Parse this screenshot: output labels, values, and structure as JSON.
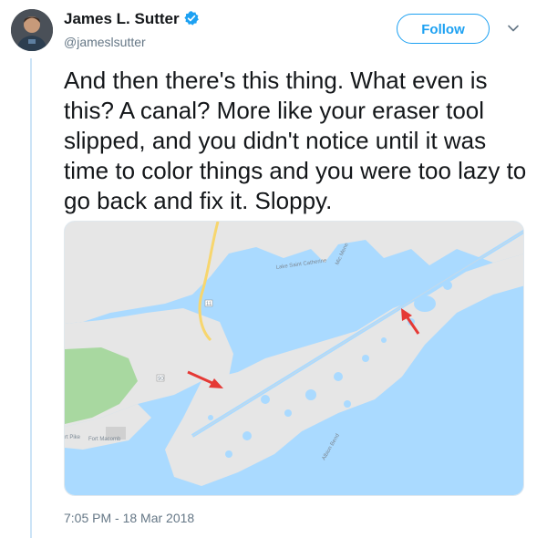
{
  "author": {
    "name": "James L. Sutter",
    "handle": "@jameslsutter",
    "verified": true
  },
  "follow_button": {
    "label": "Follow"
  },
  "tweet": {
    "text": "And then there's this thing. What even is this? A canal? More like your eraser tool slipped, and you didn't notice until it was time to color things and you were too lazy to go back and fix it. Sloppy.",
    "timestamp": "7:05 PM - 18 Mar 2018"
  },
  "map": {
    "labels": {
      "lake": "Lake Saint Catherine",
      "fort": "Fort Macomb",
      "road_shield_1": "11",
      "road_shield_2": "90",
      "bay_1": "Mic Mene",
      "bay_2": "Albion Bend",
      "fort_left": "rt Pike"
    },
    "colors": {
      "water": "#aadaff",
      "land": "#e8e8e8",
      "park": "#a8d8a0",
      "road": "#f7d66e",
      "arrow": "#e53935"
    }
  },
  "colors": {
    "accent": "#1da1f2",
    "text": "#14171a",
    "secondary": "#657786",
    "thread_line": "#cce4f7"
  }
}
